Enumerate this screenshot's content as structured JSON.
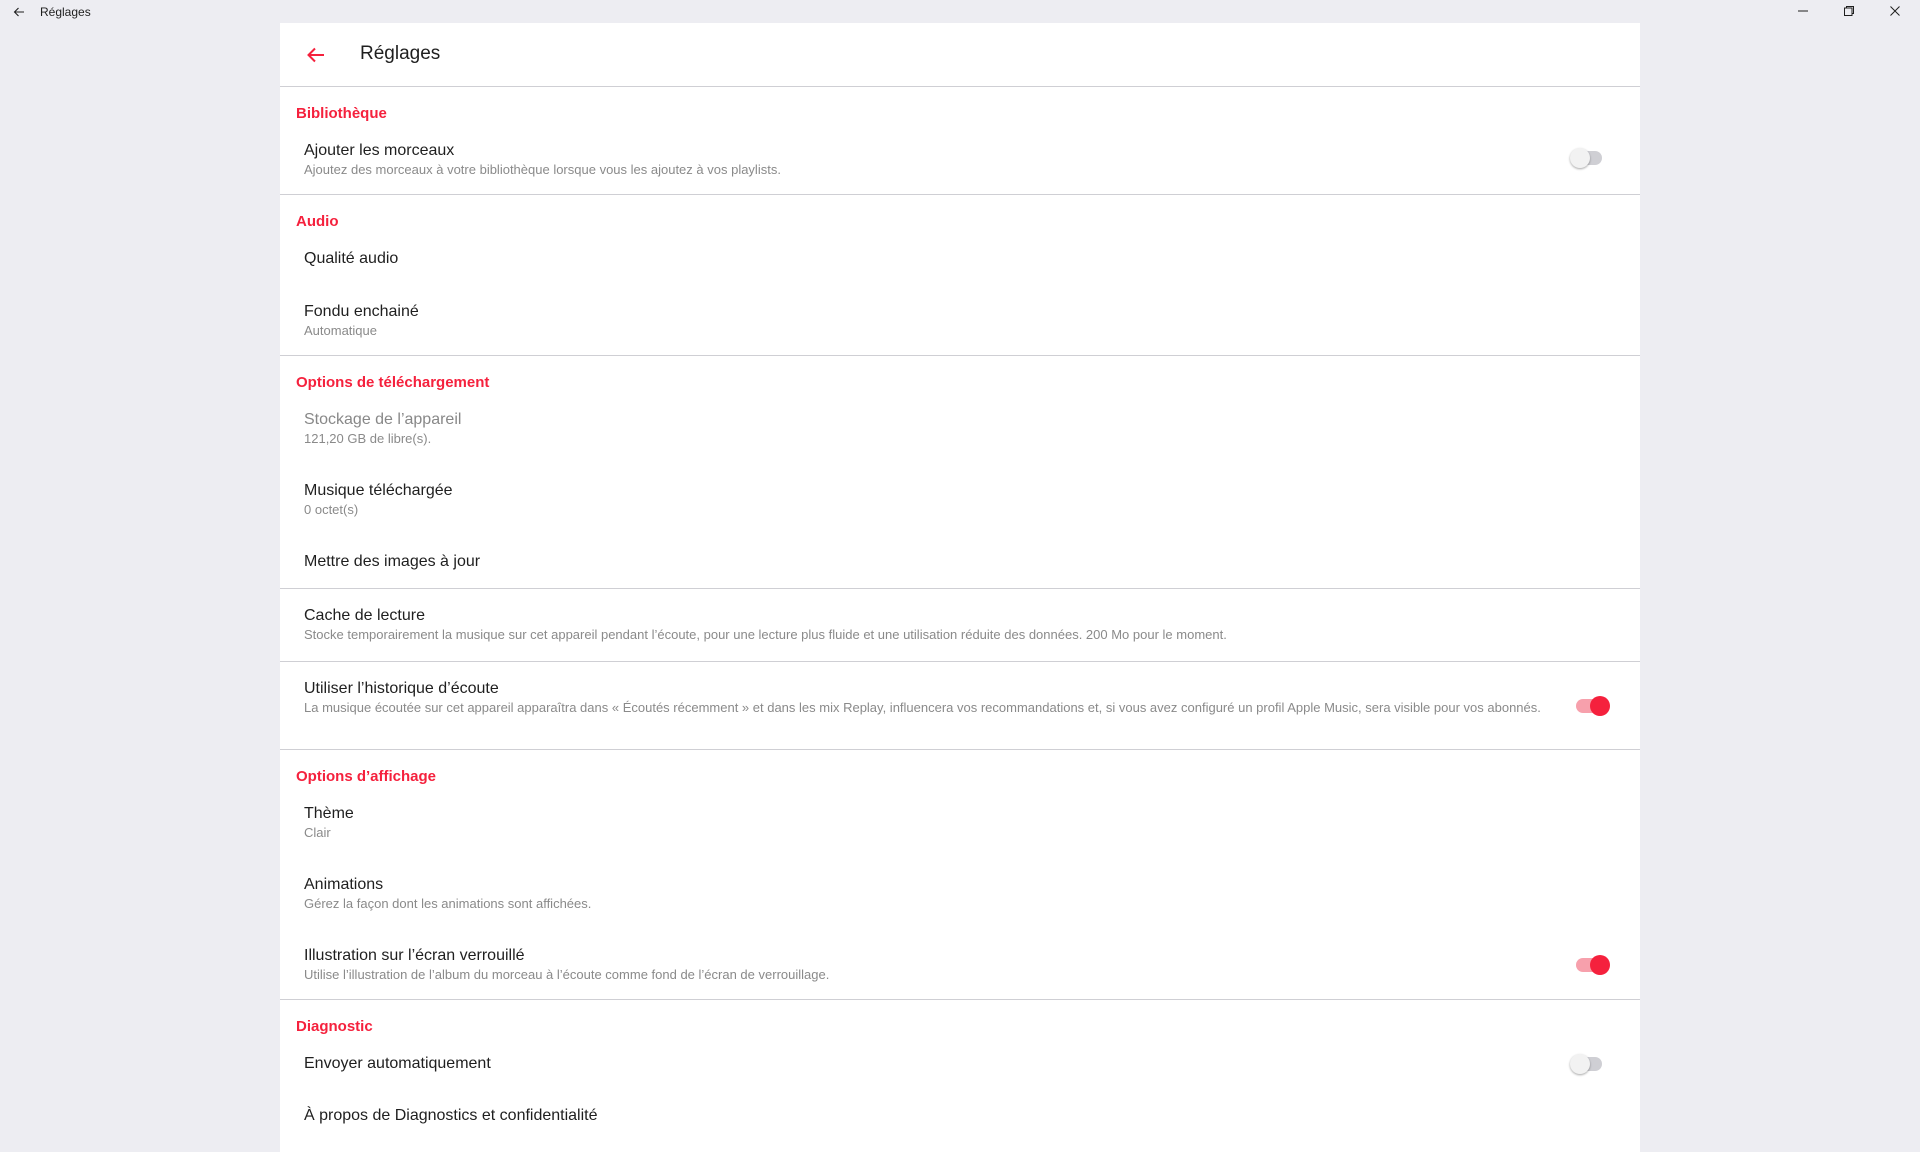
{
  "window": {
    "title": "Réglages",
    "back_icon": "arrow-left-icon",
    "minimize_icon": "minimize-icon",
    "maximize_icon": "restore-icon",
    "close_icon": "close-icon"
  },
  "header": {
    "title": "Réglages",
    "back_icon": "arrow-left-icon",
    "accent_color": "#f5213d"
  },
  "sections": {
    "library": {
      "heading": "Bibliothèque",
      "add_tracks": {
        "title": "Ajouter les morceaux",
        "subtitle": "Ajoutez des morceaux à votre bibliothèque lorsque vous les ajoutez à vos playlists.",
        "toggle": false
      }
    },
    "audio": {
      "heading": "Audio",
      "quality": {
        "title": "Qualité audio"
      },
      "crossfade": {
        "title": "Fondu enchainé",
        "subtitle": "Automatique"
      }
    },
    "download": {
      "heading": "Options de téléchargement",
      "storage": {
        "title": "Stockage de l’appareil",
        "subtitle": "121,20 GB de libre(s)."
      },
      "downloaded": {
        "title": "Musique téléchargée",
        "subtitle": "0 octet(s)"
      },
      "update_images": {
        "title": "Mettre des images à jour"
      }
    },
    "cache": {
      "title": "Cache de lecture",
      "subtitle": "Stocke temporairement la musique sur cet appareil pendant l’écoute, pour une lecture plus fluide et une utilisation réduite des données. 200 Mo pour le moment."
    },
    "history": {
      "title": "Utiliser l’historique d’écoute",
      "subtitle": "La musique écoutée sur cet appareil apparaîtra dans « Écoutés récemment » et dans les mix Replay, influencera vos recommandations et, si vous avez configuré un profil Apple Music, sera visible pour vos abonnés.",
      "toggle": true
    },
    "display": {
      "heading": "Options d’affichage",
      "theme": {
        "title": "Thème",
        "subtitle": "Clair"
      },
      "animations": {
        "title": "Animations",
        "subtitle": "Gérez la façon dont les animations sont affichées."
      },
      "lock_art": {
        "title": "Illustration sur l’écran verrouillé",
        "subtitle": "Utilise l’illustration de l’album du morceau à l’écoute comme fond de l’écran de verrouillage.",
        "toggle": true
      }
    },
    "diagnostic": {
      "heading": "Diagnostic",
      "auto_send": {
        "title": "Envoyer automatiquement",
        "toggle": false
      },
      "about": {
        "title": "À propos de Diagnostics et confidentialité"
      }
    }
  }
}
